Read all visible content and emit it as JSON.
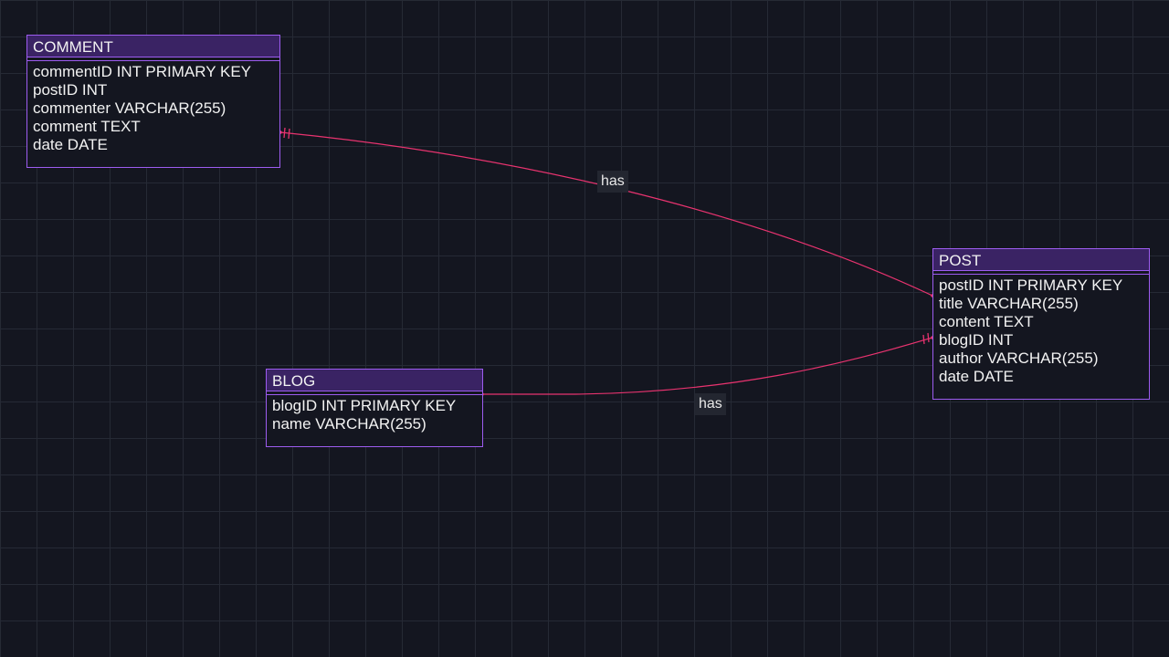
{
  "diagram": {
    "entities": [
      {
        "id": "comment",
        "name": "COMMENT",
        "attributes": [
          "commentID INT PRIMARY KEY",
          "postID INT",
          "commenter VARCHAR(255)",
          "comment TEXT",
          "date DATE"
        ]
      },
      {
        "id": "post",
        "name": "POST",
        "attributes": [
          "postID INT PRIMARY KEY",
          "title VARCHAR(255)",
          "content TEXT",
          "blogID INT",
          "author VARCHAR(255)",
          "date DATE"
        ]
      },
      {
        "id": "blog",
        "name": "BLOG",
        "attributes": [
          "blogID INT PRIMARY KEY",
          "name VARCHAR(255)"
        ]
      }
    ],
    "relationships": [
      {
        "from": "COMMENT",
        "to": "POST",
        "label": "has"
      },
      {
        "from": "BLOG",
        "to": "POST",
        "label": "has"
      }
    ]
  },
  "colors": {
    "background": "#141620",
    "grid": "#262a35",
    "entity_border": "#9d5cf0",
    "entity_header": "#3a2364",
    "relationship_line": "#e8336f",
    "label_background": "#232630"
  }
}
